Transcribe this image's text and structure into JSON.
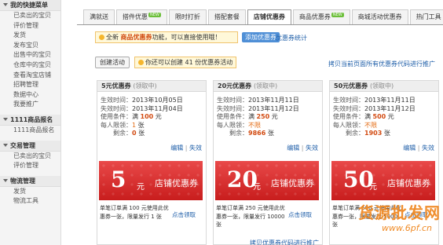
{
  "sidebar": {
    "sections": [
      {
        "title": "我的快捷菜单",
        "items": [
          "已卖出的宝贝",
          "评价管理",
          "发货",
          "发布宝贝",
          "出售中的宝贝",
          "仓库中的宝贝",
          "查看淘宝店铺",
          "招聘管理",
          "数据中心",
          "我要推广"
        ]
      },
      {
        "title": "1111商品报名",
        "items": [
          "1111商品报名"
        ]
      },
      {
        "title": "交易管理",
        "items": [
          "已卖出的宝贝",
          "评价管理"
        ]
      },
      {
        "title": "物流管理",
        "items": [
          "发货",
          "物流工具"
        ]
      }
    ]
  },
  "tabs": [
    {
      "label": "满就送",
      "badge": ""
    },
    {
      "label": "搭件优惠",
      "badge": "NEW"
    },
    {
      "label": "限时打折",
      "badge": ""
    },
    {
      "label": "搭配套餐",
      "badge": ""
    },
    {
      "label": "店铺优惠券",
      "badge": "",
      "active": true
    },
    {
      "label": "商品优惠券",
      "badge": "NEW"
    },
    {
      "label": "商城活动优惠券",
      "badge": ""
    },
    {
      "label": "热门工具",
      "badge": ""
    }
  ],
  "notice": {
    "prefix": "全新",
    "highlight": "商品优惠券",
    "suffix": "功能，可以直接使用哦！"
  },
  "add_button": "添加优惠券",
  "stats_link": "优惠券统计",
  "create_button": "创建活动",
  "create_info": "你还可以创建 41 份优惠券活动",
  "copy_link": "拷贝当前页面所有优惠券代码进行推广",
  "labels": {
    "start": "生效时间：",
    "end": "失效时间：",
    "cond": "使用条件：",
    "limit": "每人限领：",
    "remain": "剩余：",
    "edit": "编辑",
    "sep": "|",
    "expire": "失效",
    "claim": "点击领取",
    "banner_title": "店铺优惠券",
    "yuan": "元",
    "claim_note": "(领取中)"
  },
  "cards": [
    {
      "title": "5元优惠券",
      "start": "2013年10月05日",
      "end": "2013年11月04日",
      "cond_pre": "满",
      "cond_amt": "100",
      "cond_unit": "元",
      "limit_num": "1",
      "limit_unit": "张",
      "remain_num": "0",
      "remain_unit": "张",
      "amount": "5",
      "desc": "单笔订单满 100 元使用此优惠券一张，限量发行 1 张"
    },
    {
      "title": "20元优惠券",
      "start": "2013年11月11日",
      "end": "2013年11月12日",
      "cond_pre": "满",
      "cond_amt": "250",
      "cond_unit": "元",
      "limit_num": "不限",
      "limit_unit": "",
      "remain_num": "9866",
      "remain_unit": "张",
      "amount": "20",
      "desc": "单笔订单满 250 元使用此优惠券一张，限量发行 10000 张"
    },
    {
      "title": "50元优惠券",
      "start": "2013年11月11日",
      "end": "2013年11月12日",
      "cond_pre": "满",
      "cond_amt": "500",
      "cond_unit": "元",
      "limit_num": "不限",
      "limit_unit": "",
      "remain_num": "1903",
      "remain_unit": "张",
      "amount": "50",
      "desc": "单笔订单满 500 元使用此优惠券一张，限量发行 5000 张"
    }
  ],
  "bottom_link": "拷贝优惠券代码进行推广",
  "watermark": {
    "line1": "货源批发网",
    "line2": "www.6pf.cn"
  }
}
